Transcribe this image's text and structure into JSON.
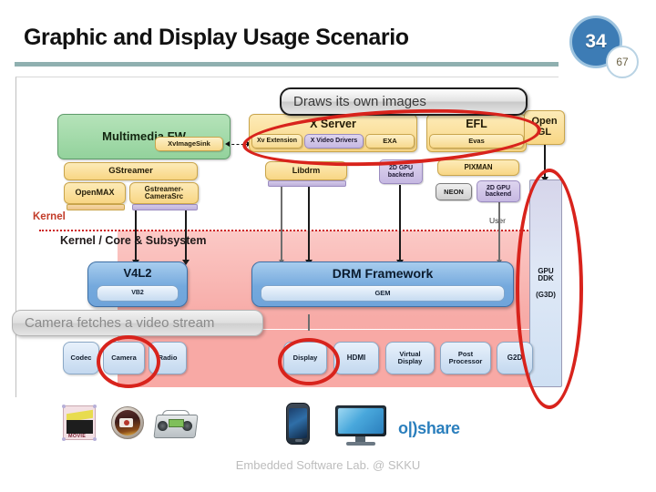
{
  "header": {
    "title": "Graphic and Display Usage Scenario",
    "badge_number": "34",
    "badge_subnumber": "67",
    "rule_color": "#8fb0b0",
    "badge_color": "#3d7cb5"
  },
  "diagram": {
    "kernel_label": "Kernel",
    "kernel_core_label": "Kernel / Core & Subsystem",
    "user_label": "User",
    "callouts": [
      {
        "id": "draws-own-images",
        "text": "Draws its own images"
      },
      {
        "id": "camera-fetches",
        "text": "Camera fetches a video stream"
      }
    ],
    "userspace_blocks": [
      {
        "id": "multimedia-fw",
        "label": "Multimedia FW"
      },
      {
        "id": "xvimagesink",
        "label": "XvImageSink"
      },
      {
        "id": "gstreamer",
        "label": "GStreamer"
      },
      {
        "id": "openmax",
        "label": "OpenMAX"
      },
      {
        "id": "gstreamer-camerasrc",
        "label": "Gstreamer-\nCameraSrc"
      },
      {
        "id": "x-server",
        "label": "X Server"
      },
      {
        "id": "xv-extension",
        "label": "Xv Extension"
      },
      {
        "id": "x-video-drivers",
        "label": "X Video Drivers"
      },
      {
        "id": "exa",
        "label": "EXA"
      },
      {
        "id": "libdrm",
        "label": "Libdrm"
      },
      {
        "id": "2d-gpu-backend-exa",
        "label": "2D GPU\nbackend"
      },
      {
        "id": "efl",
        "label": "EFL"
      },
      {
        "id": "evas",
        "label": "Evas"
      },
      {
        "id": "pixman",
        "label": "PIXMAN"
      },
      {
        "id": "neon",
        "label": "NEON"
      },
      {
        "id": "2d-gpu-backend-efl",
        "label": "2D GPU\nbackend"
      },
      {
        "id": "opengl",
        "label": "Open\nGL"
      }
    ],
    "kernel_blocks": [
      {
        "id": "v4l2",
        "label": "V4L2"
      },
      {
        "id": "vb2",
        "label": "VB2"
      },
      {
        "id": "drm-framework",
        "label": "DRM Framework"
      },
      {
        "id": "gem",
        "label": "GEM"
      },
      {
        "id": "gpu-ddk",
        "label": "GPU\nDDK",
        "sublabel": "(G3D)"
      }
    ],
    "hardware_blocks": [
      {
        "id": "codec",
        "label": "Codec"
      },
      {
        "id": "camera",
        "label": "Camera"
      },
      {
        "id": "radio",
        "label": "Radio"
      },
      {
        "id": "display",
        "label": "Display"
      },
      {
        "id": "hdmi",
        "label": "HDMI"
      },
      {
        "id": "virtual-display",
        "label": "Virtual\nDisplay"
      },
      {
        "id": "post-processor",
        "label": "Post\nProcessor"
      },
      {
        "id": "g2d",
        "label": "G2D"
      }
    ],
    "annotation_color": "#d8231c",
    "annotations": [
      {
        "id": "ellipse-userspace-stack",
        "target": "X Server / EFL row"
      },
      {
        "id": "ellipse-camera",
        "target": "Camera"
      },
      {
        "id": "ellipse-display",
        "target": "Display"
      },
      {
        "id": "ellipse-gpu-ddk",
        "target": "GPU DDK column"
      }
    ]
  },
  "device_icons": [
    {
      "id": "movie-icon",
      "label": "MOVIE"
    },
    {
      "id": "camera-icon",
      "label": ""
    },
    {
      "id": "radio-icon",
      "label": ""
    },
    {
      "id": "phone-icon",
      "label": ""
    },
    {
      "id": "monitor-icon",
      "label": ""
    }
  ],
  "allshare_logo": "o|)share",
  "footer": {
    "text": "Embedded Software Lab. @ SKKU"
  }
}
